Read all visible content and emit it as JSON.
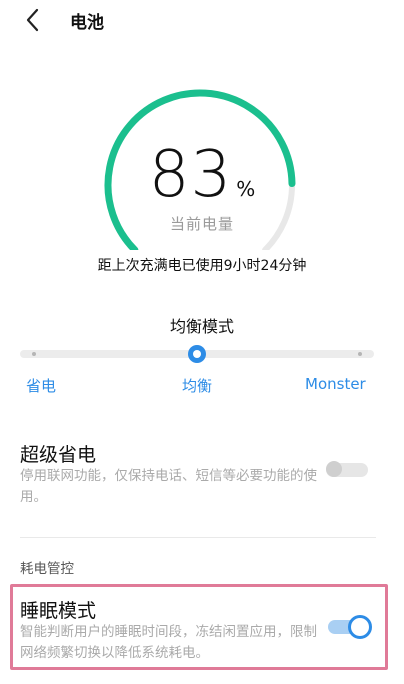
{
  "header": {
    "title": "电池"
  },
  "battery": {
    "level_percent": 83,
    "percent_text": "83",
    "percent_sign": "%",
    "label": "当前电量",
    "since_full_charge": "距上次充满电已使用9小时24分钟"
  },
  "mode": {
    "title": "均衡模式",
    "selected_index": 1,
    "stops": [
      "省电",
      "均衡",
      "Monster"
    ]
  },
  "super_power_saving": {
    "title": "超级省电",
    "description": "停用联网功能，仅保持电话、短信等必要功能的使用。",
    "enabled": false
  },
  "power_control": {
    "section_label": "耗电管控"
  },
  "sleep_mode": {
    "title": "睡眠模式",
    "description": "智能判断用户的睡眠时间段，冻结闲置应用，限制网络频繁切换以降低系统耗电。",
    "enabled": true
  },
  "colors": {
    "gauge_fill": "#1bbf8e",
    "gauge_track": "#e8e8e8",
    "accent": "#2d8ce6",
    "highlight": "#e07a98"
  },
  "icons": {
    "back": "chevron-left-icon"
  }
}
